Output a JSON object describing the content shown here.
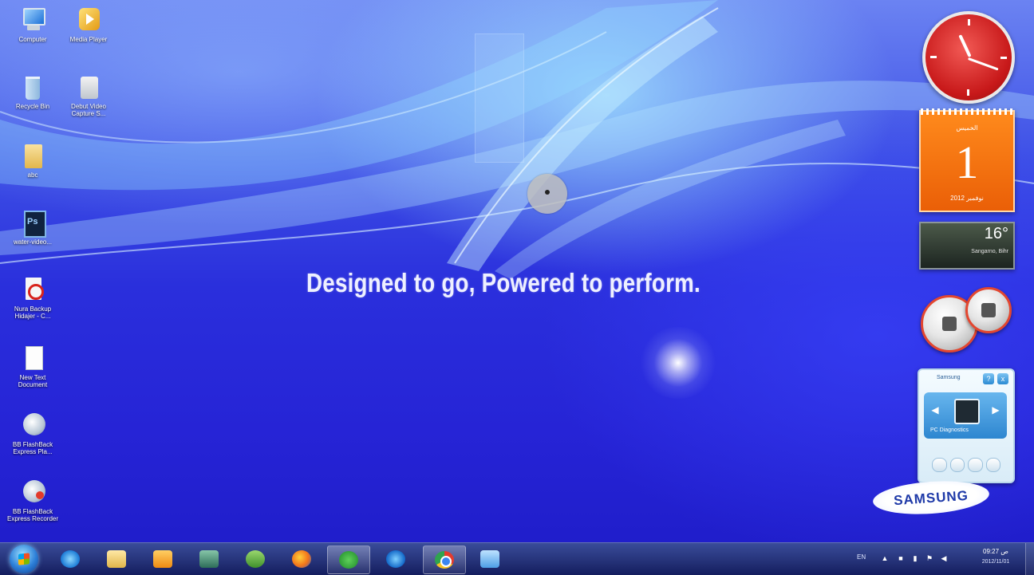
{
  "wallpaper": {
    "slogan": "Designed to go, Powered to perform.",
    "colors": {
      "top": "#6b83f2",
      "bottom": "#1e1cc8"
    }
  },
  "desktop_icons": [
    {
      "label": "Computer",
      "icon": "computer-icon"
    },
    {
      "label": "Media Player",
      "icon": "media-player-icon"
    },
    {
      "label": "Recycle Bin",
      "icon": "recycle-bin-icon"
    },
    {
      "label": "Debut Video Capture S...",
      "icon": "video-capture-icon"
    },
    {
      "label": "abc",
      "icon": "folder-icon"
    },
    {
      "label": "water-video...",
      "icon": "photoshop-file-icon"
    },
    {
      "label": "Nura Backup Hidajer - C...",
      "icon": "pdf-icon"
    },
    {
      "label": "New Text Document",
      "icon": "text-document-icon"
    },
    {
      "label": "BB FlashBack Express Pla...",
      "icon": "flashback-player-icon"
    },
    {
      "label": "BB FlashBack Express Recorder",
      "icon": "flashback-recorder-icon"
    }
  ],
  "gadgets": {
    "clock": {
      "color": "#c8191a"
    },
    "calendar": {
      "day_name": "الخميس",
      "day": "1",
      "month_year": "نوفمبر 2012"
    },
    "weather": {
      "temperature": "16°",
      "location": "Sangarno, Bihr"
    },
    "samsung_gadget": {
      "title": "Samsung",
      "panel_label": "PC Diagnostics",
      "help": "?",
      "close": "x"
    },
    "samsung_logo": "SAMSUNG"
  },
  "taskbar": {
    "items": [
      {
        "name": "internet-explorer",
        "icon": "internet-explorer-icon",
        "active": false
      },
      {
        "name": "windows-explorer",
        "icon": "folder-icon",
        "active": false
      },
      {
        "name": "media-player",
        "icon": "media-player-icon",
        "active": false
      },
      {
        "name": "screen-app",
        "icon": "screen-icon",
        "active": false
      },
      {
        "name": "messenger",
        "icon": "people-icon",
        "active": false
      },
      {
        "name": "firefox",
        "icon": "firefox-icon",
        "active": false
      },
      {
        "name": "utorrent",
        "icon": "utorrent-icon",
        "active": true
      },
      {
        "name": "internet-explorer-2",
        "icon": "internet-explorer-icon",
        "active": false
      },
      {
        "name": "chrome",
        "icon": "chrome-icon",
        "active": true
      },
      {
        "name": "folder-app",
        "icon": "folder-icon",
        "active": false
      }
    ],
    "tray": {
      "language": "EN",
      "time": "09:27 ص",
      "date": "2012/11/01"
    }
  }
}
